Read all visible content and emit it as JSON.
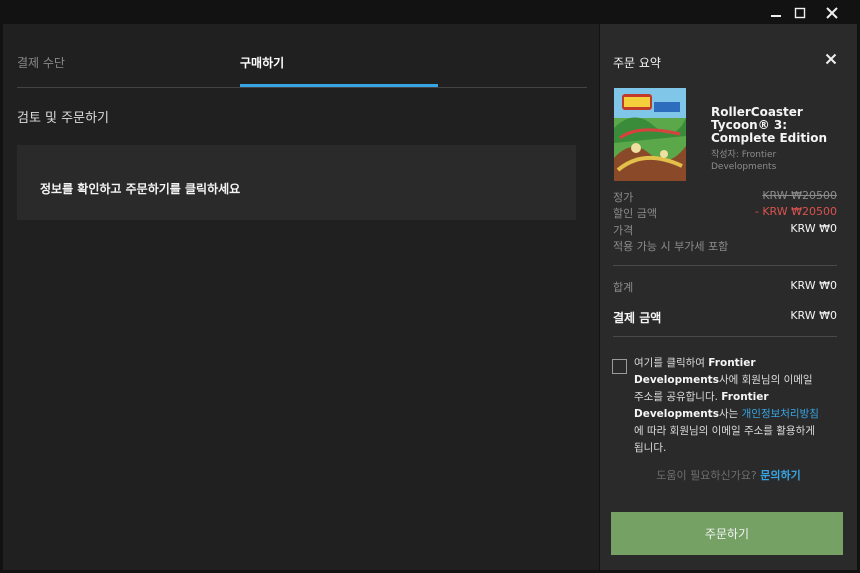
{
  "tabs": {
    "payment": "결제 수단",
    "purchase": "구매하기"
  },
  "review": {
    "title": "검토 및 주문하기",
    "info": "정보를 확인하고 주문하기를 클릭하세요"
  },
  "summary": {
    "title": "주문 요약",
    "game": {
      "title": "RollerCoaster Tycoon® 3: Complete Edition",
      "publisher": "작성자: Frontier Developments"
    },
    "price_label": "정가",
    "price_value": "KRW ₩20500",
    "discount_label": "할인 금액",
    "discount_value": "- KRW ₩20500",
    "final_label": "가격",
    "final_value": "KRW ₩0",
    "vat_note": "적용 가능 시 부가세 포함",
    "total_label": "합계",
    "total_value": "KRW ₩0",
    "payment_label": "결제 금액",
    "payment_value": "KRW ₩0"
  },
  "consent": {
    "part1": "여기를 클릭하여 ",
    "publisher1": "Frontier Developments",
    "part2": "사에 회원님의 이메일 주소를 공유합니다. ",
    "publisher2": "Frontier Developments",
    "part3": "사는 ",
    "privacy_link": "개인정보처리방침",
    "part4": "에 따라 회원님의 이메일 주소를 활용하게 됩니다."
  },
  "help": {
    "question": "도움이 필요하신가요? ",
    "link": "문의하기"
  },
  "order_button": "주문하기",
  "colors": {
    "accent": "#37a5e4",
    "order": "#75a165",
    "discount": "#d9534f"
  },
  "icons": [
    "minimize-icon",
    "maximize-icon",
    "close-icon",
    "close-summary-icon",
    "game-thumbnail"
  ]
}
